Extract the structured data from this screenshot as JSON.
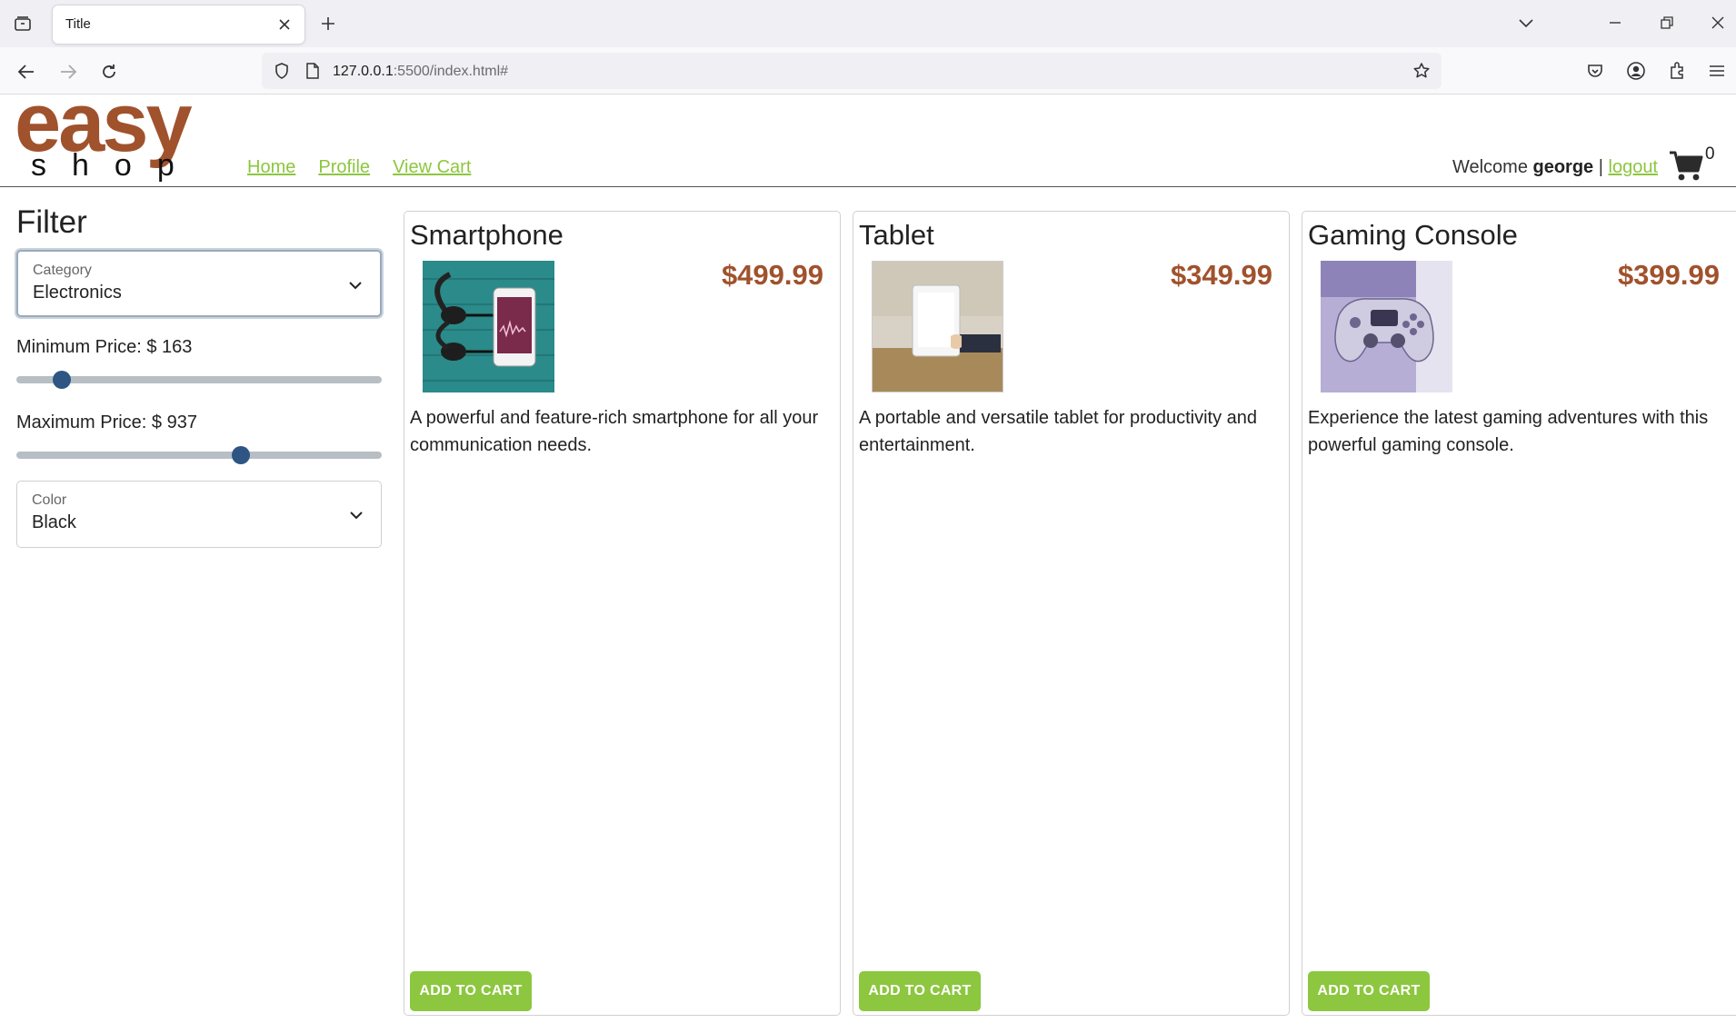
{
  "browser": {
    "tab_title": "Title",
    "url_host": "127.0.0.1",
    "url_rest": ":5500/index.html#"
  },
  "header": {
    "logo_top": "easy",
    "logo_bottom": "shop",
    "nav": [
      {
        "label": "Home"
      },
      {
        "label": "Profile"
      },
      {
        "label": "View Cart"
      }
    ],
    "welcome_prefix": "Welcome ",
    "username": "george",
    "separator": " | ",
    "logout_label": "logout",
    "cart_count": "0"
  },
  "filter": {
    "title": "Filter",
    "category_label": "Category",
    "category_value": "Electronics",
    "min_price_label": "Minimum Price: $ 163",
    "min_price_value": 163,
    "max_price_label": "Maximum Price: $ 937",
    "max_price_value": 937,
    "color_label": "Color",
    "color_value": "Black"
  },
  "products": [
    {
      "name": "Smartphone",
      "price": "$499.99",
      "description": "A powerful and feature-rich smartphone for all your communication needs.",
      "button": "ADD TO CART"
    },
    {
      "name": "Tablet",
      "price": "$349.99",
      "description": "A portable and versatile tablet for productivity and entertainment.",
      "button": "ADD TO CART"
    },
    {
      "name": "Gaming Console",
      "price": "$399.99",
      "description": "Experience the latest gaming adventures with this powerful gaming console.",
      "button": "ADD TO CART"
    }
  ],
  "colors": {
    "brand": "#a0522d",
    "accent_green": "#8dc63f",
    "slider_thumb": "#2e5583"
  }
}
